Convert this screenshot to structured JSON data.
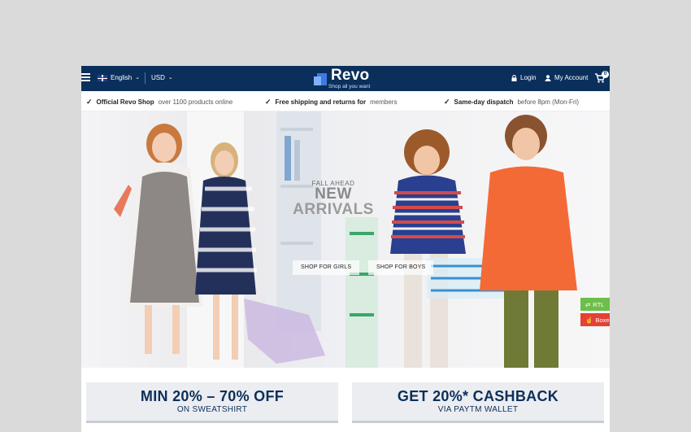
{
  "topbar": {
    "language": "English",
    "currency": "USD",
    "logo_name": "Revo",
    "logo_tagline": "Shop all you want",
    "login": "Login",
    "account": "My Account",
    "cart_count": "0"
  },
  "infobar": [
    {
      "bold": "Official Revo Shop",
      "light": "over 1100 products online"
    },
    {
      "bold": "Free shipping and returns for",
      "light": "members"
    },
    {
      "bold": "Same-day dispatch",
      "light": "before 8pm (Mon-Fri)"
    }
  ],
  "hero": {
    "kicker": "FALL AHEAD",
    "title_line1": "NEW",
    "title_line2": "ARRIVALS",
    "btn_girls": "SHOP FOR GIRLS",
    "btn_boys": "SHOP FOR BOYS"
  },
  "side_buttons": {
    "rtl": "RTL",
    "boxed": "Boxed"
  },
  "promos": [
    {
      "main": "MIN 20% – 70% OFF",
      "sub": "ON SWEATSHIRT"
    },
    {
      "main": "GET 20%* CASHBACK",
      "sub": "VIA PAYTM WALLET"
    }
  ],
  "colors": {
    "navy": "#0b2f5b",
    "rtl_green": "#6cbf4a",
    "boxed_red": "#e34234",
    "backdrop": "#dadada"
  }
}
